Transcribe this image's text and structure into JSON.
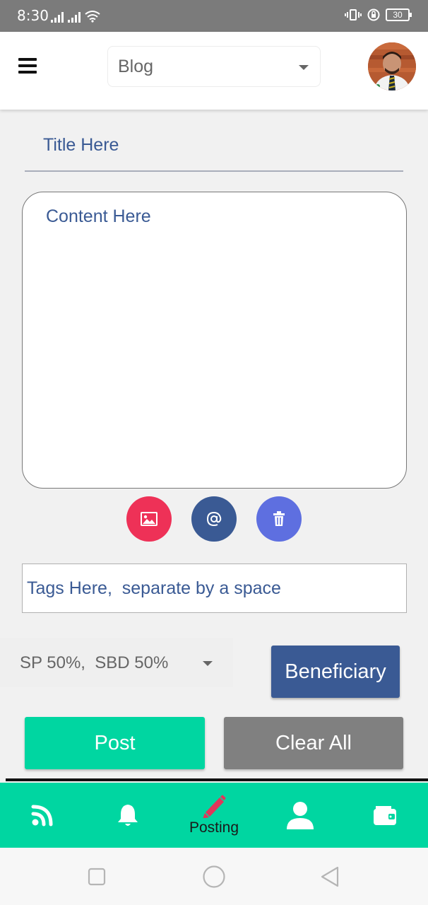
{
  "status_bar": {
    "time": "8:30",
    "battery": "30"
  },
  "header": {
    "blog_select": {
      "value": "Blog"
    }
  },
  "form": {
    "title_placeholder": "Title Here",
    "content_placeholder": "Content Here",
    "tags_placeholder": "Tags Here,  separate by a space",
    "payout_select": {
      "value": "SP 50%,  SBD 50%"
    },
    "beneficiary_label": "Beneficiary",
    "post_label": "Post",
    "clear_all_label": "Clear All"
  },
  "toolbar_icons": [
    "image-icon",
    "at-icon",
    "trash-icon"
  ],
  "bottom_nav": {
    "items": [
      {
        "icon": "rss-feed-icon",
        "label": ""
      },
      {
        "icon": "bell-icon",
        "label": ""
      },
      {
        "icon": "pencil-icon",
        "label": "Posting",
        "active": true
      },
      {
        "icon": "user-icon",
        "label": ""
      },
      {
        "icon": "wallet-icon",
        "label": ""
      }
    ]
  },
  "colors": {
    "accent_green": "#00d6a1",
    "primary_blue": "#3a5a94",
    "image_button_red": "#ee3157",
    "delete_button_indigo": "#5e6fe0",
    "clear_gray": "#808080",
    "active_pencil": "#e0365a"
  }
}
